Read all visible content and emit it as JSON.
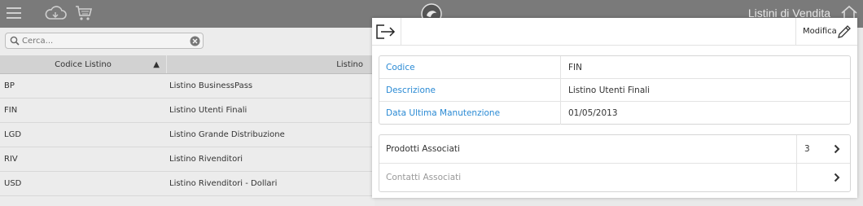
{
  "topbar": {
    "title": "Listini di Vendita",
    "icons": [
      "menu-icon",
      "cloud-icon",
      "cart-icon",
      "logo-icon",
      "home-icon"
    ]
  },
  "search": {
    "placeholder": "Cerca..."
  },
  "list": {
    "headers": {
      "code": "Codice Listino",
      "name": "Listino",
      "sort_indicator": "▲"
    },
    "rows": [
      {
        "code": "BP",
        "name": "Listino BusinessPass"
      },
      {
        "code": "FIN",
        "name": "Listino Utenti Finali"
      },
      {
        "code": "LGD",
        "name": "Listino Grande Distribuzione"
      },
      {
        "code": "RIV",
        "name": "Listino Rivenditori"
      },
      {
        "code": "USD",
        "name": "Listino Rivenditori - Dollari"
      }
    ]
  },
  "detail": {
    "edit_label": "Modifica",
    "fields": [
      {
        "label": "Codice",
        "value": "FIN"
      },
      {
        "label": "Descrizione",
        "value": "Listino Utenti Finali"
      },
      {
        "label": "Data Ultima Manutenzione",
        "value": "01/05/2013"
      }
    ],
    "links": [
      {
        "label": "Prodotti Associati",
        "count": "3"
      },
      {
        "label": "Contatti Associati",
        "count": ""
      }
    ]
  },
  "colors": {
    "accent": "#2a8ad4",
    "topbar": "#7a7a7a"
  }
}
